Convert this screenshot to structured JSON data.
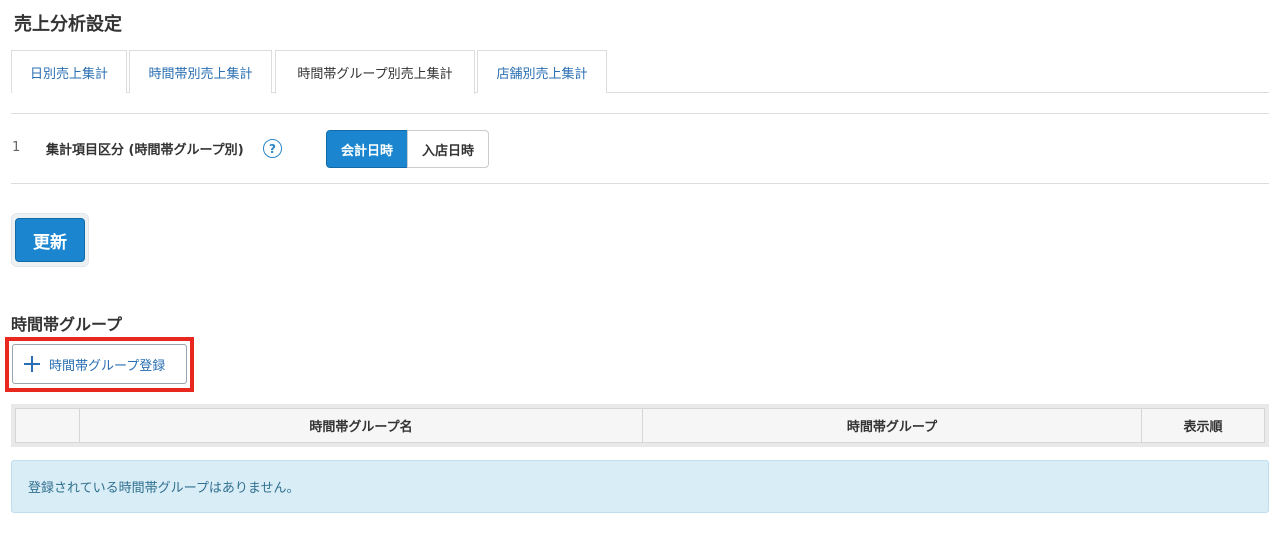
{
  "page": {
    "title": "売上分析設定"
  },
  "tabs": [
    {
      "label": "日別売上集計",
      "active": false
    },
    {
      "label": "時間帯別売上集計",
      "active": false
    },
    {
      "label": "時間帯グループ別売上集計",
      "active": true
    },
    {
      "label": "店舗別売上集計",
      "active": false
    }
  ],
  "setting": {
    "number": "1",
    "label": "集計項目区分 (時間帯グループ別)",
    "help_icon": "?",
    "options": [
      {
        "label": "会計日時",
        "selected": true
      },
      {
        "label": "入店日時",
        "selected": false
      }
    ]
  },
  "update_button": {
    "label": "更新"
  },
  "group_section": {
    "title": "時間帯グループ",
    "add_button": {
      "label": "時間帯グループ登録",
      "icon": "plus-icon"
    },
    "table": {
      "headers": [
        "",
        "時間帯グループ名",
        "時間帯グループ",
        "表示順"
      ]
    },
    "empty_message": "登録されている時間帯グループはありません。"
  },
  "colors": {
    "primary": "#1b86cf",
    "link": "#2a6fb3",
    "highlight": "#e8271f",
    "info_bg": "#d9edf7",
    "info_text": "#31708f"
  }
}
